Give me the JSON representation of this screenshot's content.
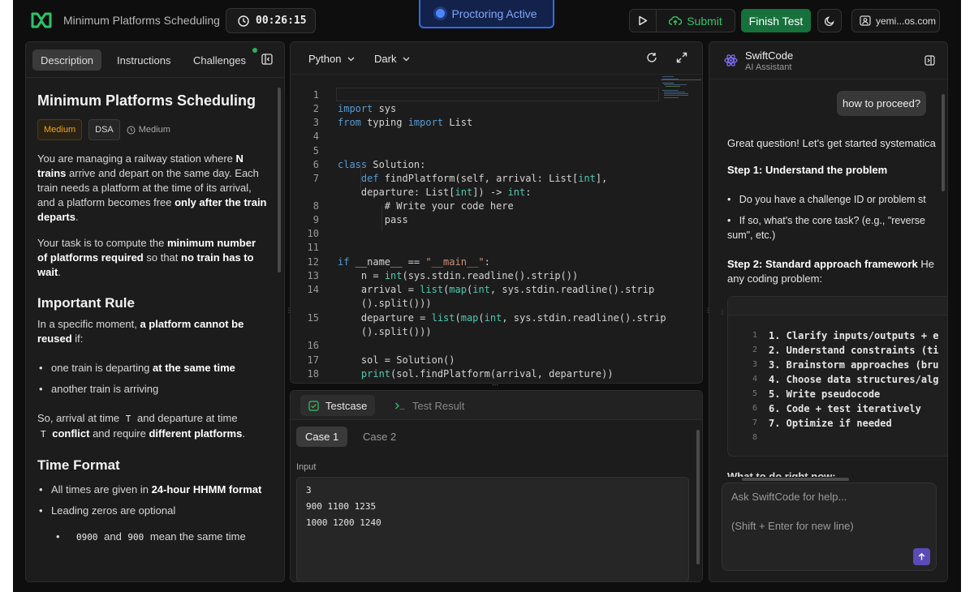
{
  "header": {
    "title": "Minimum Platforms Scheduling",
    "timer": "00:26:15",
    "proctoring": "Proctoring Active",
    "submit_label": "Submit",
    "finish_label": "Finish Test",
    "user": "yemi...os.com"
  },
  "left_panel": {
    "tabs": [
      {
        "label": "Description"
      },
      {
        "label": "Instructions"
      },
      {
        "label": "Challenges"
      }
    ],
    "title": "Minimum Platforms Scheduling",
    "badge_difficulty": "Medium",
    "badge_category": "DSA",
    "badge_time": "Medium",
    "p1": {
      "t1": "You are managing a railway station where ",
      "b1": "N trains",
      "t2": " arrive and depart on the same day. Each train needs a platform at the time of its arrival, and a platform becomes free ",
      "b2": "only after the train departs",
      "t3": "."
    },
    "p2": {
      "t1": "Your task is to compute the ",
      "b1": "minimum number of platforms required",
      "t2": " so that ",
      "b2": "no train has to wait",
      "t3": "."
    },
    "rule_heading": "Important Rule",
    "rule_p": {
      "t1": "In a specific moment, ",
      "b1": "a platform cannot be reused",
      "t2": " if:"
    },
    "rule_items": [
      {
        "t": "one train is departing ",
        "b": "at the same time"
      },
      {
        "t": "another train is arriving",
        "b": ""
      }
    ],
    "conflict": {
      "t1": "So, arrival at time ",
      "c1": "T",
      "t2": " and departure at time ",
      "c2": "T",
      "b1": " conflict",
      "t3": " and require ",
      "b2": "different platforms",
      "t4": "."
    },
    "time_heading": "Time Format",
    "time_items": {
      "i1_t": "All times are given in ",
      "i1_b": "24-hour HHMM format",
      "i2": "Leading zeros are optional",
      "sub_c1": "0900",
      "sub_t1": " and ",
      "sub_c2": "900",
      "sub_t2": " mean the same time"
    }
  },
  "editor": {
    "language": "Python",
    "theme": "Dark",
    "lines": [
      {
        "n": "1",
        "top": 0
      },
      {
        "n": "2"
      },
      {
        "n": "3"
      },
      {
        "n": "4"
      },
      {
        "n": "5"
      },
      {
        "n": "6"
      },
      {
        "n": "7"
      },
      {
        "n": "8"
      },
      {
        "n": "9"
      },
      {
        "n": "10"
      },
      {
        "n": "11"
      },
      {
        "n": "12"
      },
      {
        "n": "13"
      },
      {
        "n": "14"
      },
      {
        "n": "15"
      },
      {
        "n": "16"
      },
      {
        "n": "17"
      },
      {
        "n": "18"
      }
    ],
    "code": {
      "l2a": "import",
      "l2b": " sys",
      "l3a": "from",
      "l3b": " typing ",
      "l3c": "import",
      "l3d": " List",
      "l6a": "class",
      "l6b": " Solution:",
      "l7a": "    def",
      "l7b": " findPlatform(self, arrival: List[",
      "l7c": "int",
      "l7d": "],",
      "l7e": "    departure: List[",
      "l7f": "int",
      "l7g": "]) -> ",
      "l7h": "int",
      "l7i": ":",
      "l8": "        # Write your code here",
      "l9": "        pass",
      "l12a": "if",
      "l12b": " __name__ == ",
      "l12c": "\"__main__\"",
      "l12d": ":",
      "l13a": "    n = ",
      "l13b": "int",
      "l13c": "(sys.stdin.readline().strip())",
      "l14a": "    arrival = ",
      "l14b": "list",
      "l14c": "(",
      "l14d": "map",
      "l14e": "(",
      "l14f": "int",
      "l14g": ", sys.stdin.readline().strip",
      "l14h": "    ().split()))",
      "l15a": "    departure = ",
      "l15b": "list",
      "l15c": "(",
      "l15d": "map",
      "l15e": "(",
      "l15f": "int",
      "l15g": ", sys.stdin.readline().strip",
      "l15h": "    ().split()))",
      "l17": "    sol = Solution()",
      "l18a": "    ",
      "l18b": "print",
      "l18c": "(sol.findPlatform(arrival, departure))"
    }
  },
  "testpanel": {
    "tab_testcase": "Testcase",
    "tab_result": "Test Result",
    "case1": "Case 1",
    "case2": "Case 2",
    "input_label": "Input",
    "input_lines": [
      "3",
      "900 1100 1235",
      "1000 1200 1240"
    ]
  },
  "assistant": {
    "name": "SwiftCode",
    "subtitle": "AI Assistant",
    "user_msg": "how to proceed?",
    "intro": "Great question! Let's get started systematica",
    "step1": "Step 1: Understand the problem",
    "bullet1": "Do you have a challenge ID or problem st",
    "bullet2a": "If so, what's the core task? (e.g., \"reverse",
    "bullet2b": "sum\", etc.)",
    "step2": "Step 2: Standard approach framework",
    "step2_rest": " He",
    "step2_line2": "any coding problem:",
    "code_lines": [
      {
        "n": "1",
        "t": "1. Clarify inputs/outputs + e"
      },
      {
        "n": "2",
        "t": "2. Understand constraints (ti"
      },
      {
        "n": "3",
        "t": "3. Brainstorm approaches (bru"
      },
      {
        "n": "4",
        "t": "4. Choose data structures/alg"
      },
      {
        "n": "5",
        "t": "5. Write pseudocode"
      },
      {
        "n": "6",
        "t": "6. Code + test iteratively"
      },
      {
        "n": "7",
        "t": "7. Optimize if needed"
      },
      {
        "n": "8",
        "t": ""
      }
    ],
    "cut_text": "What to do right now:",
    "placeholder1": "Ask SwiftCode for help...",
    "placeholder2": "(Shift + Enter for new line)"
  },
  "colors": {
    "accent_green": "#16713c",
    "proctor_blue": "#2b6de0",
    "send_purple": "#5b4bb8"
  }
}
